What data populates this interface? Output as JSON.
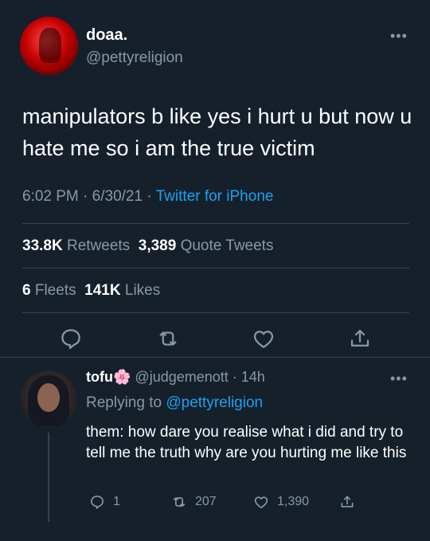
{
  "tweet": {
    "display_name": "doaa.",
    "handle": "@pettyreligion",
    "text": "manipulators b like yes i hurt u but now u hate me so i am the true victim",
    "time": "6:02 PM",
    "date": "6/30/21",
    "source": "Twitter for iPhone",
    "retweets_count": "33.8K",
    "retweets_label": "Retweets",
    "quotes_count": "3,389",
    "quotes_label": "Quote Tweets",
    "fleets_count": "6",
    "fleets_label": "Fleets",
    "likes_count": "141K",
    "likes_label": "Likes"
  },
  "reply": {
    "display_name": "tofu",
    "emoji": "🌸",
    "handle": "@judgemenott",
    "age": "14h",
    "replying_label": "Replying to",
    "replying_handle": "@pettyreligion",
    "text": "them: how dare you realise what i did and try to tell me the truth why are you hurting me like this",
    "reply_count": "1",
    "retweet_count": "207",
    "like_count": "1,390"
  },
  "icons": {
    "more": "more-icon",
    "reply": "reply-icon",
    "retweet": "retweet-icon",
    "like": "heart-icon",
    "share": "share-icon"
  },
  "colors": {
    "background": "#15202b",
    "muted": "#8899a6",
    "link": "#1da1f2",
    "divider": "#38444d"
  }
}
